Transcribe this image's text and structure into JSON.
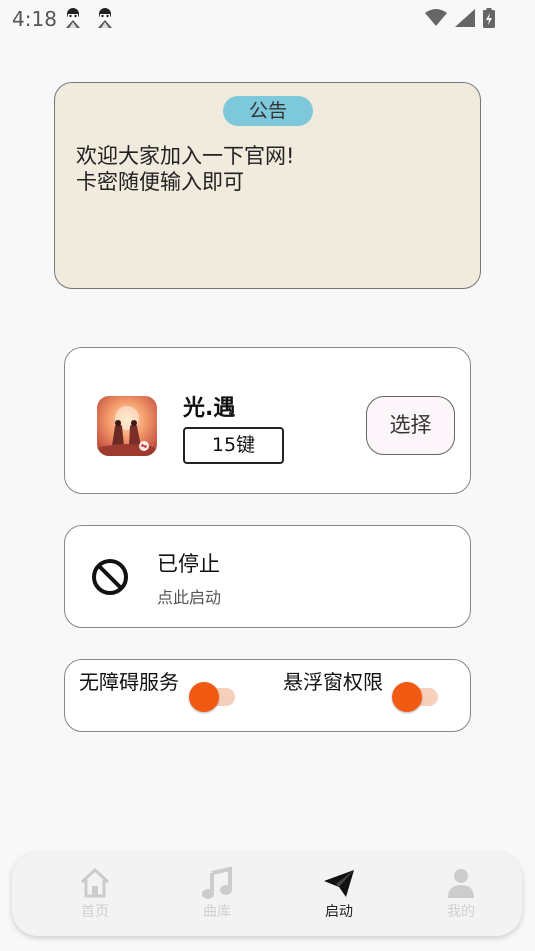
{
  "status_bar": {
    "time": "4:18",
    "notification_icons": [
      "anime-avatar-icon",
      "anime-avatar-icon"
    ],
    "right_icons": [
      "wifi-icon",
      "signal-icon",
      "battery-charging-icon"
    ]
  },
  "notice": {
    "badge": "公告",
    "text": "欢迎大家加入一下官网!\n卡密随便输入即可"
  },
  "game": {
    "icon": "game-app-icon",
    "title": "光.遇",
    "key_mode": "15键",
    "select_label": "选择"
  },
  "service": {
    "icon": "prohibited-icon",
    "title": "已停止",
    "subtitle": "点此启动"
  },
  "permissions": {
    "accessibility_label": "无障碍服务",
    "accessibility_on": true,
    "overlay_label": "悬浮窗权限",
    "overlay_on": true
  },
  "nav": {
    "items": [
      {
        "label": "首页",
        "icon": "home-icon",
        "active": false
      },
      {
        "label": "曲库",
        "icon": "music-note-icon",
        "active": false
      },
      {
        "label": "启动",
        "icon": "paper-plane-icon",
        "active": true
      },
      {
        "label": "我的",
        "icon": "person-icon",
        "active": false
      }
    ]
  },
  "colors": {
    "notice_bg": "#f1ebde",
    "badge_bg": "#7ec8dc",
    "toggle_thumb": "#f15a12",
    "toggle_track": "#f7d0bc"
  }
}
